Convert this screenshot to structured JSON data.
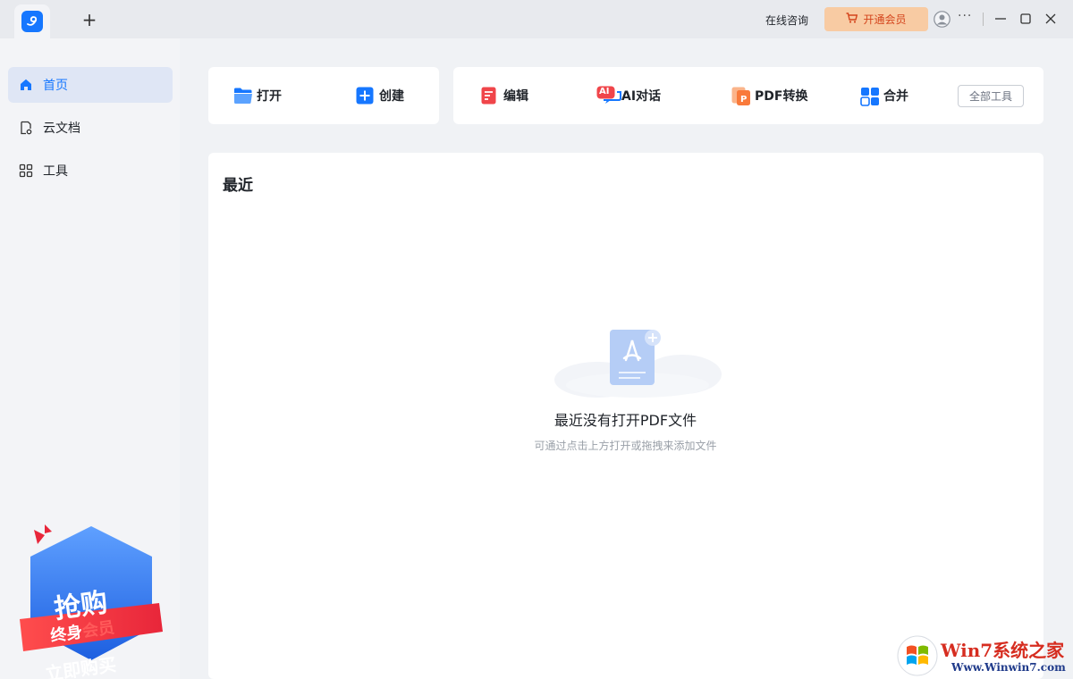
{
  "titlebar": {
    "new_tab": "+",
    "consult": "在线咨询",
    "vip_button": "开通会员",
    "more": "···"
  },
  "sidebar": {
    "items": [
      {
        "label": "首页",
        "icon": "home-icon",
        "active": true
      },
      {
        "label": "云文档",
        "icon": "cloud-doc-icon",
        "active": false
      },
      {
        "label": "工具",
        "icon": "grid-icon",
        "active": false
      }
    ],
    "promo": {
      "line1": "抢购",
      "line2a": "终身",
      "line2b": "会员",
      "cta": "立即购买"
    }
  },
  "toolbar": {
    "open": "打开",
    "create": "创建",
    "edit": "编辑",
    "ai_chat": "AI对话",
    "ai_badge": "AI",
    "pdf_convert": "PDF转换",
    "merge": "合并",
    "all_tools": "全部工具"
  },
  "recent": {
    "title": "最近",
    "empty_title": "最近没有打开PDF文件",
    "empty_subtitle": "可通过点击上方打开或拖拽来添加文件"
  },
  "watermark": {
    "brand": "Win7系统之家",
    "url": "Www.Winwin7.com"
  },
  "colors": {
    "accent": "#1677ff",
    "vip_bg": "#f8cba3",
    "vip_text": "#d4441c",
    "edit_red": "#f0454a",
    "convert_orange": "#f97a3b"
  }
}
